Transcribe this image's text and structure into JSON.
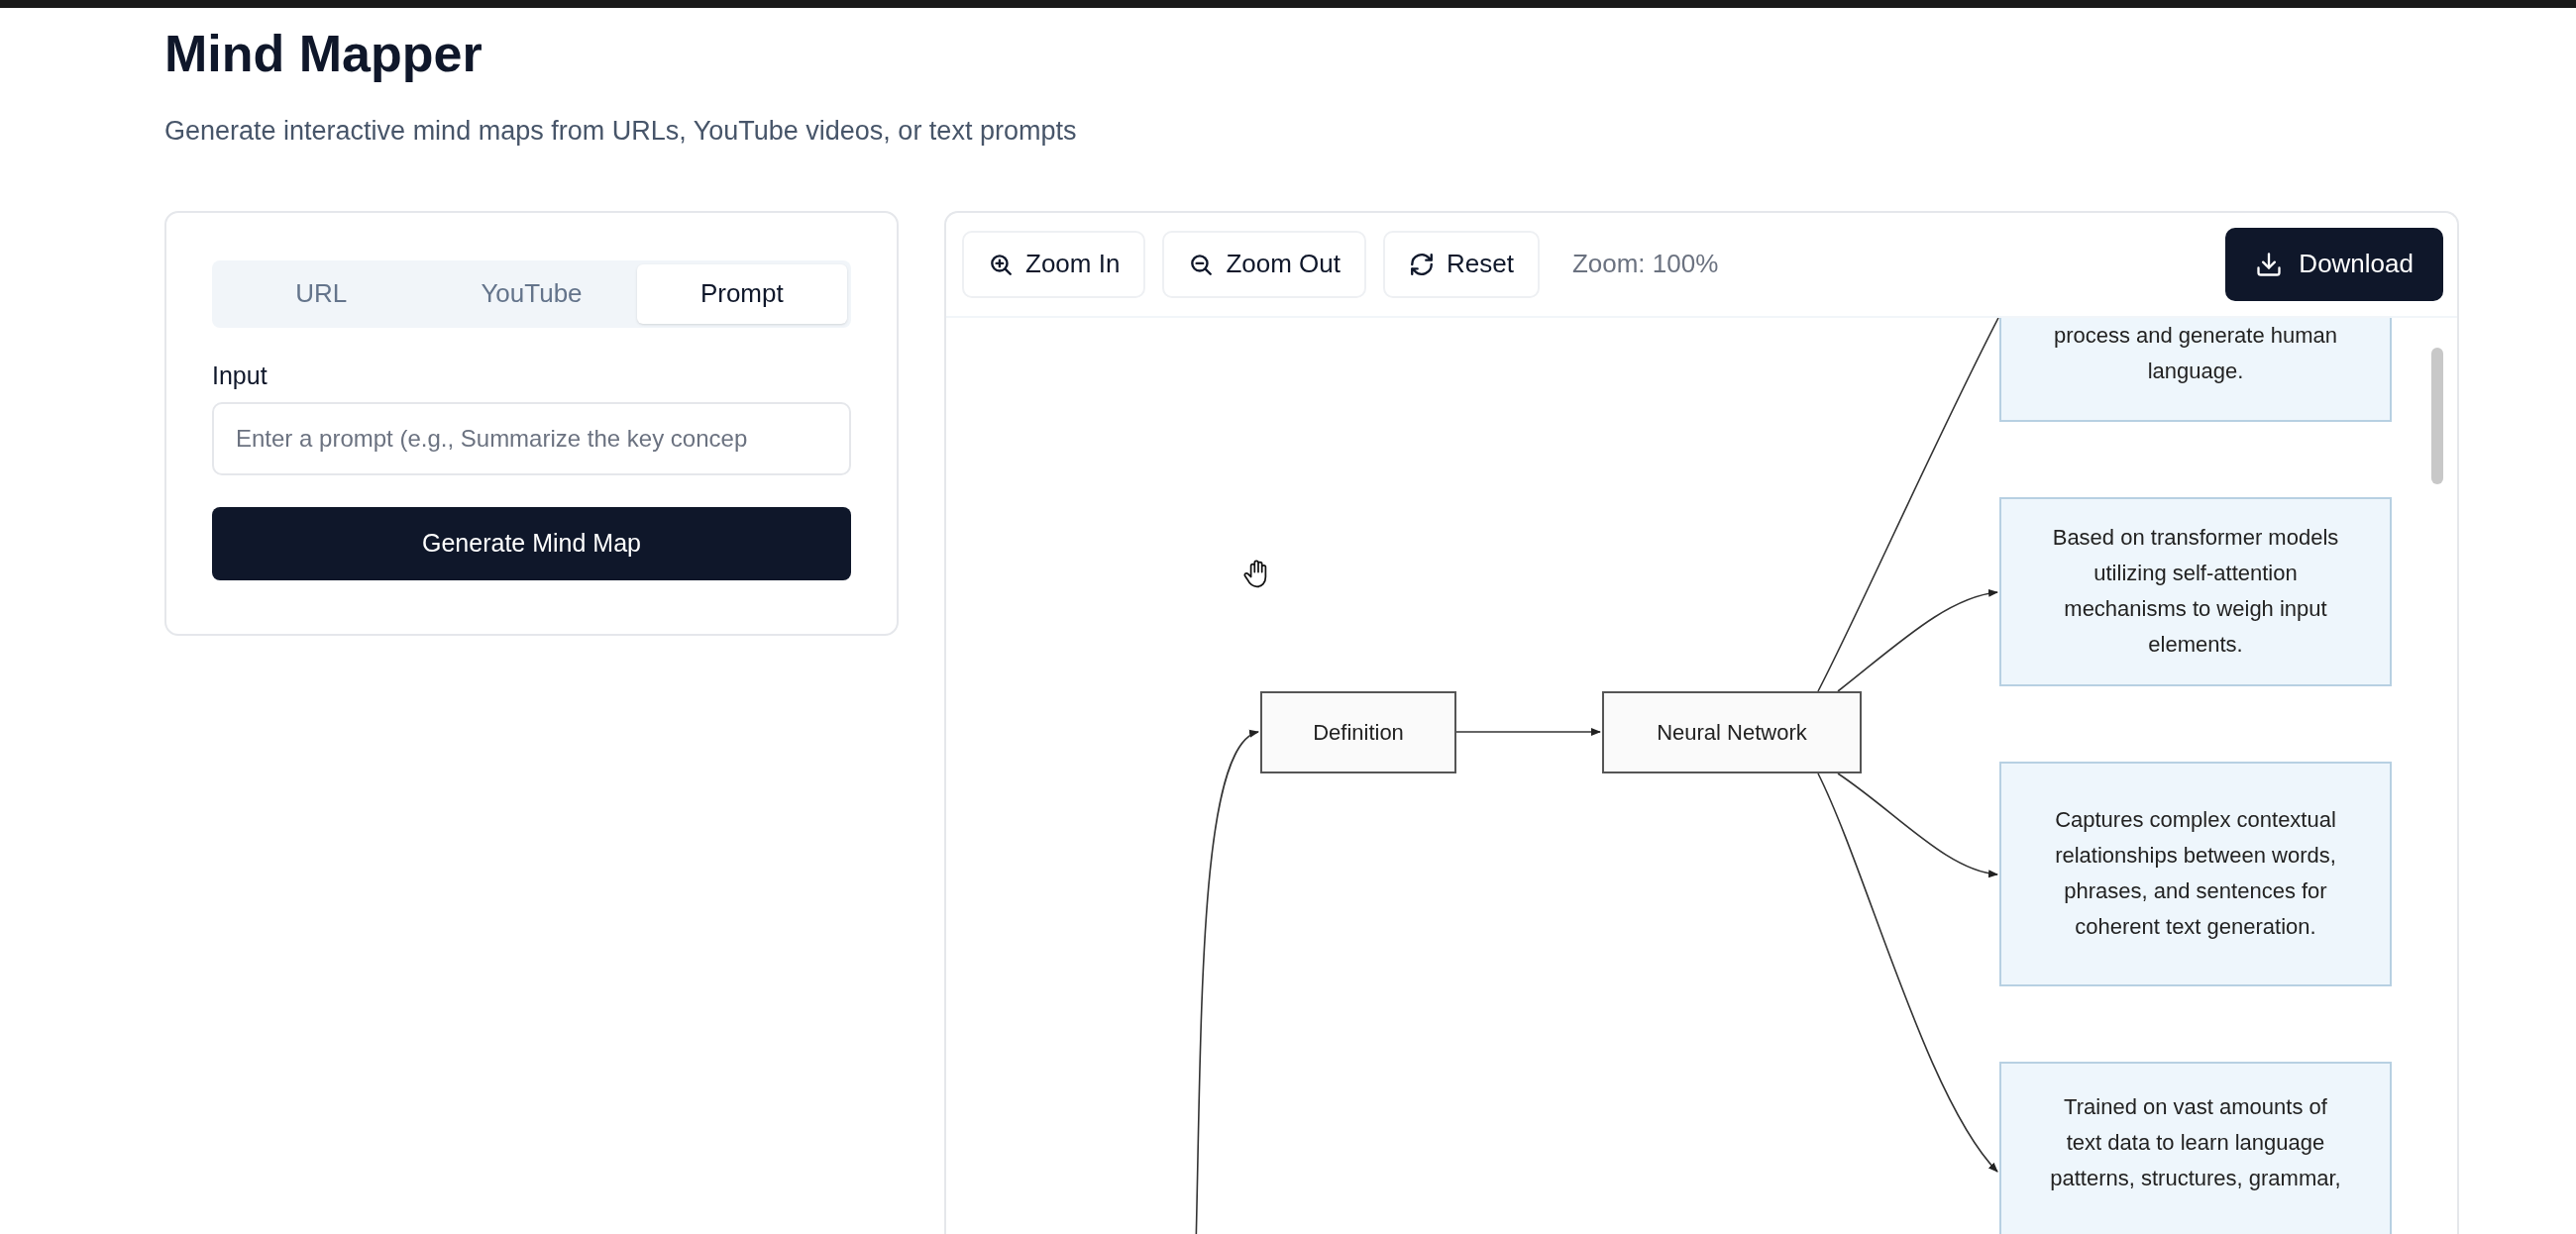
{
  "title": "Mind Mapper",
  "subtitle": "Generate interactive mind maps from URLs, YouTube videos, or text prompts",
  "input_panel": {
    "tabs": [
      {
        "label": "URL",
        "selected": false
      },
      {
        "label": "YouTube",
        "selected": false
      },
      {
        "label": "Prompt",
        "selected": true
      }
    ],
    "input_label": "Input",
    "input": {
      "placeholder": "Enter a prompt (e.g., Summarize the key concep"
    },
    "generate_button": "Generate Mind Map"
  },
  "viewer": {
    "toolbar": {
      "buttons": [
        {
          "kind": "zoom-in",
          "label": "Zoom In"
        },
        {
          "kind": "zoom-out",
          "label": "Zoom Out"
        },
        {
          "kind": "reset",
          "label": "Reset"
        }
      ],
      "zoom_level": "Zoom: 100%",
      "download_button": "Download"
    },
    "mind_map": {
      "nodes": [
        {
          "kind": "topic",
          "label": "Definition"
        },
        {
          "kind": "topic",
          "label": "Neural Network"
        },
        {
          "kind": "detail",
          "label": "process and generate human language."
        },
        {
          "kind": "detail",
          "label": "Based on transformer models utilizing self-attention mechanisms to weigh input elements."
        },
        {
          "kind": "detail",
          "label": "Captures complex contextual relationships between words, phrases, and sentences for coherent text generation."
        },
        {
          "kind": "detail",
          "label": "Trained on vast amounts of text data to learn language patterns, structures, grammar,"
        }
      ]
    }
  }
}
